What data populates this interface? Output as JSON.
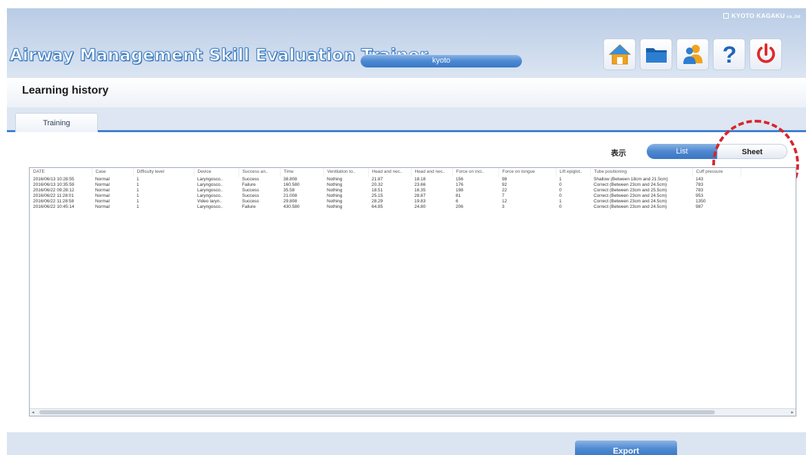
{
  "header": {
    "brand": "KYOTO KAGAKU",
    "brand_suffix": "co.,ltd",
    "app_title": "Airway Management Skill Evaluation Trainer",
    "user_name": "kyoto",
    "toolbar": [
      {
        "id": "home",
        "icon": "home-icon"
      },
      {
        "id": "folder",
        "icon": "folder-icon"
      },
      {
        "id": "user",
        "icon": "user-icon"
      },
      {
        "id": "help",
        "icon": "help-icon"
      },
      {
        "id": "power",
        "icon": "power-icon"
      }
    ]
  },
  "page": {
    "title": "Learning history"
  },
  "tabs": [
    {
      "label": "Training",
      "active": true
    }
  ],
  "view": {
    "display_label": "表示",
    "list_label": "List",
    "sheet_label": "Sheet",
    "selected": "List"
  },
  "table": {
    "columns": [
      "DATE",
      "Case",
      "Difficulty level",
      "Device",
      "Success an..",
      "Time",
      "Ventilation to..",
      "Head and nec..",
      "Head and nec..",
      "Force on inci..",
      "Force on tongue",
      "Lift epiglot..",
      "Tube positioning",
      "Cuff pressure"
    ],
    "rows": [
      [
        "2016/06/13 10:28:55",
        "Normal",
        "1",
        "Laryngosco..",
        "Success",
        "38.808",
        "Nothing",
        "21.87",
        "18.18",
        "156",
        "98",
        "1",
        "Shallow (Between 18cm and 21.5cm)",
        "143"
      ],
      [
        "2016/06/13 10:35:59",
        "Normal",
        "1",
        "Laryngosco..",
        "Failure",
        "160.580",
        "Nothing",
        "20.32",
        "23.66",
        "176",
        "92",
        "0",
        "Correct (Between 23cm and 24.5cm)",
        "783"
      ],
      [
        "2016/06/22 09:28:12",
        "Normal",
        "1",
        "Laryngosco..",
        "Success",
        "35.58",
        "Nothing",
        "18.51",
        "16.35",
        "198",
        "22",
        "0",
        "Correct (Between 23cm and 25.5cm)",
        "783"
      ],
      [
        "2016/06/22 11:28:01",
        "Normal",
        "1",
        "Laryngosco..",
        "Success",
        "21.008",
        "Nothing",
        "25.15",
        "28.87",
        "81",
        "7",
        "0",
        "Correct (Between 23cm and 24.5cm)",
        "953"
      ],
      [
        "2016/06/22 11:28:58",
        "Normal",
        "1",
        "Video laryn..",
        "Success",
        "29.808",
        "Nothing",
        "28.29",
        "19.83",
        "6",
        "12",
        "1",
        "Correct (Between 23cm and 24.5cm)",
        "1350"
      ],
      [
        "2016/06/22 10:45:14",
        "Normal",
        "1",
        "Laryngosco..",
        "Failure",
        "430.580",
        "Nothing",
        "64.85",
        "24.80",
        "206",
        "3",
        "0",
        "Correct (Between 23cm and 24.5cm)",
        "987"
      ]
    ]
  },
  "footer": {
    "export_label": "Export"
  },
  "colors": {
    "accent": "#3f7fcf",
    "highlight": "#d9252b",
    "header_bg": "#c5d5eb"
  }
}
